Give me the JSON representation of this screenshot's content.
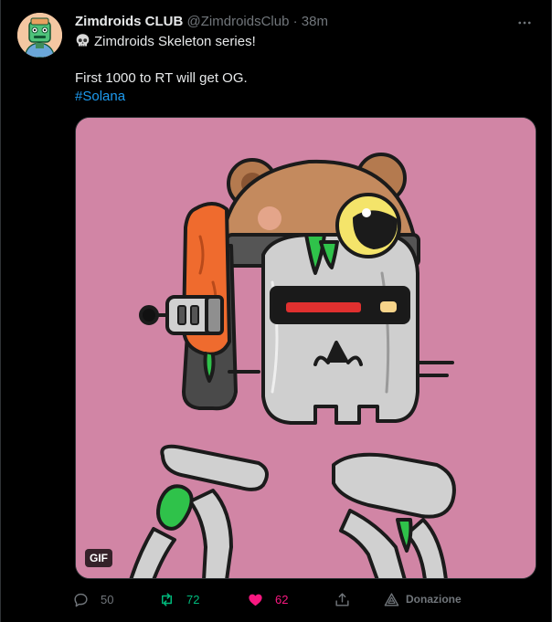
{
  "author": {
    "display_name": "Zimdroids CLUB",
    "handle": "@ZimdroidsClub",
    "separator": "·",
    "time": "38m"
  },
  "tweet": {
    "line1": "Zimdroids Skeleton series!",
    "line2": "First 1000 to RT will get OG.",
    "hashtag": "#Solana"
  },
  "media": {
    "badge": "GIF",
    "background": "#d185a5"
  },
  "actions": {
    "replies": "50",
    "retweets": "72",
    "likes": "62",
    "donate_label": "Donazione"
  },
  "icons": {
    "more": "more-horizontal-icon",
    "reply": "reply-bubble-icon",
    "retweet": "retweet-icon",
    "like": "heart-icon",
    "share": "share-icon",
    "donate": "donate-icon"
  },
  "colors": {
    "retweet_active": "#00ba7c",
    "like_active": "#f91880",
    "hashtag": "#1d9bf0",
    "muted": "#71767b"
  }
}
